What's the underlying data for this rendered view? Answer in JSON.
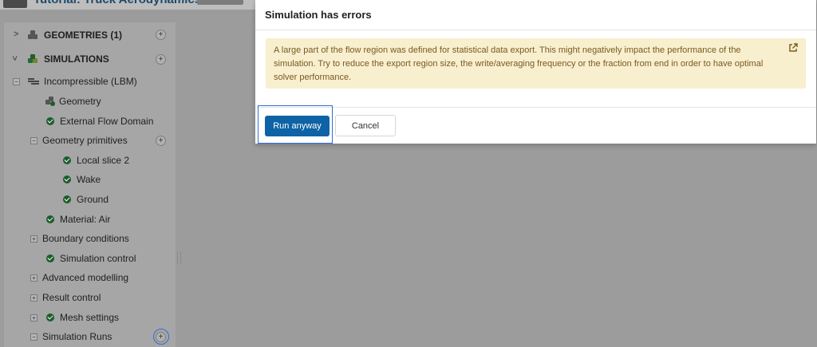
{
  "app": {
    "title": "Tutorial: Truck Aerodynamics"
  },
  "tree": {
    "geometries": {
      "label": "GEOMETRIES (1)"
    },
    "simulations": {
      "label": "SIMULATIONS"
    },
    "items": [
      {
        "label": "Incompressible (LBM)"
      },
      {
        "label": "Geometry"
      },
      {
        "label": "External Flow Domain"
      },
      {
        "label": "Geometry primitives"
      },
      {
        "label": "Local slice 2"
      },
      {
        "label": "Wake"
      },
      {
        "label": "Ground"
      },
      {
        "label": "Material: Air"
      },
      {
        "label": "Boundary conditions"
      },
      {
        "label": "Simulation control"
      },
      {
        "label": "Advanced modelling"
      },
      {
        "label": "Result control"
      },
      {
        "label": "Mesh settings"
      },
      {
        "label": "Simulation Runs"
      }
    ]
  },
  "dialog": {
    "title": "Simulation has errors",
    "alert_text": "A large part of the flow region was defined for statistical data export. This might negatively impact the performance of the simulation. Try to reduce the export region size, the write/averaging frequency or the fraction from end in order to have optimal solver performance.",
    "run_label": "Run anyway",
    "cancel_label": "Cancel"
  },
  "icons": {
    "external_link": "external-link-icon",
    "check": "check-circle-icon",
    "add": "plus-circle-icon"
  },
  "colors": {
    "primary": "#0d63a5",
    "alert_bg": "#f8efcf",
    "alert_text": "#7a5a1e",
    "highlight": "#2f6ed6",
    "success": "#1c5c2a"
  }
}
